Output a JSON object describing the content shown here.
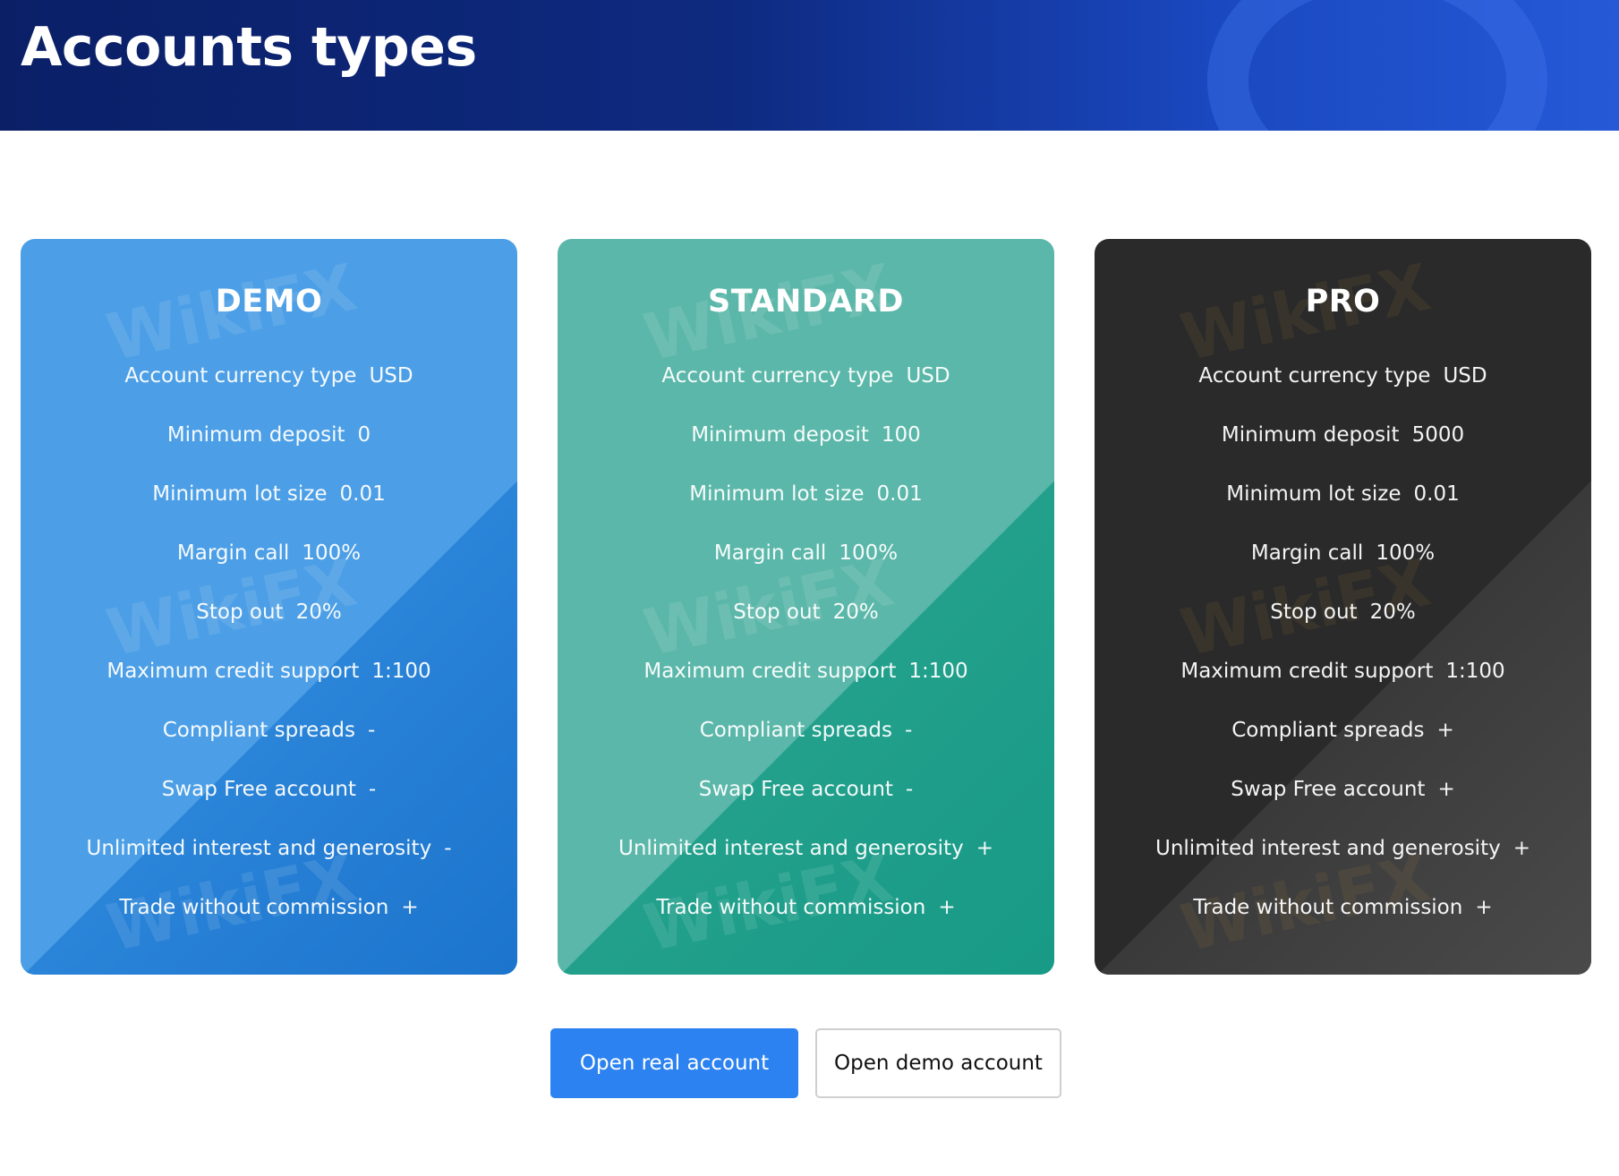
{
  "header": {
    "title": "Accounts types"
  },
  "cards": [
    {
      "title": "DEMO",
      "rows": [
        {
          "label": "Account currency type",
          "value": "USD"
        },
        {
          "label": "Minimum deposit",
          "value": "0"
        },
        {
          "label": "Minimum lot size",
          "value": "0.01"
        },
        {
          "label": "Margin call",
          "value": "100%"
        },
        {
          "label": "Stop out",
          "value": "20%"
        },
        {
          "label": "Maximum credit support",
          "value": "1:100"
        },
        {
          "label": "Compliant spreads",
          "value": "-"
        },
        {
          "label": "Swap Free account",
          "value": "-"
        },
        {
          "label": "Unlimited interest and generosity",
          "value": "-"
        },
        {
          "label": "Trade without commission",
          "value": "+"
        }
      ]
    },
    {
      "title": "STANDARD",
      "rows": [
        {
          "label": "Account currency type",
          "value": "USD"
        },
        {
          "label": "Minimum deposit",
          "value": "100"
        },
        {
          "label": "Minimum lot size",
          "value": "0.01"
        },
        {
          "label": "Margin call",
          "value": "100%"
        },
        {
          "label": "Stop out",
          "value": "20%"
        },
        {
          "label": "Maximum credit support",
          "value": "1:100"
        },
        {
          "label": "Compliant spreads",
          "value": "-"
        },
        {
          "label": "Swap Free account",
          "value": "-"
        },
        {
          "label": "Unlimited interest and generosity",
          "value": "+"
        },
        {
          "label": "Trade without commission",
          "value": "+"
        }
      ]
    },
    {
      "title": "PRO",
      "rows": [
        {
          "label": "Account currency type",
          "value": "USD"
        },
        {
          "label": "Minimum deposit",
          "value": "5000"
        },
        {
          "label": "Minimum lot size",
          "value": "0.01"
        },
        {
          "label": "Margin call",
          "value": "100%"
        },
        {
          "label": "Stop out",
          "value": "20%"
        },
        {
          "label": "Maximum credit support",
          "value": "1:100"
        },
        {
          "label": "Compliant spreads",
          "value": "+"
        },
        {
          "label": "Swap Free account",
          "value": "+"
        },
        {
          "label": "Unlimited interest and generosity",
          "value": "+"
        },
        {
          "label": "Trade without commission",
          "value": "+"
        }
      ]
    }
  ],
  "buttons": {
    "open_real": "Open real account",
    "open_demo": "Open demo account"
  },
  "watermark": "WikiFX",
  "colors": {
    "demo": "#4c9fe6",
    "standard": "#5bb7a9",
    "pro": "#2a2a2a",
    "primary_button": "#2b82f0",
    "header_dark": "#0a1f66"
  }
}
